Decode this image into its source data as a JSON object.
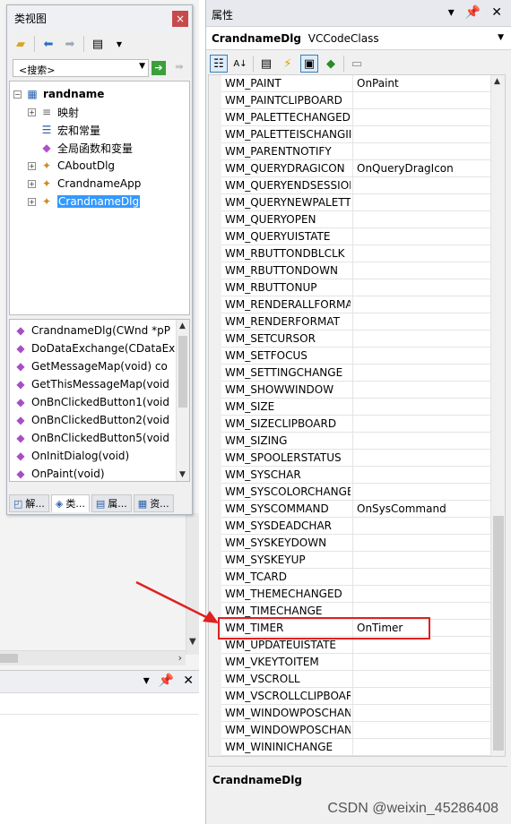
{
  "class_view": {
    "title": "类视图",
    "close": "×",
    "search_placeholder": "<搜索>",
    "tree": [
      {
        "label": "randname",
        "bold": true,
        "expander": "−",
        "icon": "project-icon"
      },
      {
        "label": "映射",
        "expander": "+",
        "icon": "map-icon"
      },
      {
        "label": "宏和常量",
        "icon": "macro-icon"
      },
      {
        "label": "全局函数和变量",
        "icon": "global-icon"
      },
      {
        "label": "CAboutDlg",
        "expander": "+",
        "icon": "class-icon"
      },
      {
        "label": "CrandnameApp",
        "expander": "+",
        "icon": "class-icon"
      },
      {
        "label": "CrandnameDlg",
        "expander": "+",
        "icon": "class-icon",
        "selected": true
      }
    ],
    "members": [
      "CrandnameDlg(CWnd *pP",
      "DoDataExchange(CDataEx",
      "GetMessageMap(void) co",
      "GetThisMessageMap(void",
      "OnBnClickedButton1(void",
      "OnBnClickedButton2(void",
      "OnBnClickedButton5(void",
      "OnInitDialog(void)",
      "OnPaint(void)"
    ],
    "tabs": [
      "解...",
      "类...",
      "属...",
      "资..."
    ]
  },
  "properties": {
    "title": "属性",
    "object_name": "CrandnameDlg",
    "object_type": "VCCodeClass",
    "rows": [
      {
        "name": "WM_PAINT",
        "value": "OnPaint"
      },
      {
        "name": "WM_PAINTCLIPBOARD",
        "value": ""
      },
      {
        "name": "WM_PALETTECHANGED",
        "value": ""
      },
      {
        "name": "WM_PALETTEISCHANGING",
        "value": ""
      },
      {
        "name": "WM_PARENTNOTIFY",
        "value": ""
      },
      {
        "name": "WM_QUERYDRAGICON",
        "value": "OnQueryDragIcon"
      },
      {
        "name": "WM_QUERYENDSESSION",
        "value": ""
      },
      {
        "name": "WM_QUERYNEWPALETTE",
        "value": ""
      },
      {
        "name": "WM_QUERYOPEN",
        "value": ""
      },
      {
        "name": "WM_QUERYUISTATE",
        "value": ""
      },
      {
        "name": "WM_RBUTTONDBLCLK",
        "value": ""
      },
      {
        "name": "WM_RBUTTONDOWN",
        "value": ""
      },
      {
        "name": "WM_RBUTTONUP",
        "value": ""
      },
      {
        "name": "WM_RENDERALLFORMATS",
        "value": ""
      },
      {
        "name": "WM_RENDERFORMAT",
        "value": ""
      },
      {
        "name": "WM_SETCURSOR",
        "value": ""
      },
      {
        "name": "WM_SETFOCUS",
        "value": ""
      },
      {
        "name": "WM_SETTINGCHANGE",
        "value": ""
      },
      {
        "name": "WM_SHOWWINDOW",
        "value": ""
      },
      {
        "name": "WM_SIZE",
        "value": ""
      },
      {
        "name": "WM_SIZECLIPBOARD",
        "value": ""
      },
      {
        "name": "WM_SIZING",
        "value": ""
      },
      {
        "name": "WM_SPOOLERSTATUS",
        "value": ""
      },
      {
        "name": "WM_SYSCHAR",
        "value": ""
      },
      {
        "name": "WM_SYSCOLORCHANGE",
        "value": ""
      },
      {
        "name": "WM_SYSCOMMAND",
        "value": "OnSysCommand"
      },
      {
        "name": "WM_SYSDEADCHAR",
        "value": ""
      },
      {
        "name": "WM_SYSKEYDOWN",
        "value": ""
      },
      {
        "name": "WM_SYSKEYUP",
        "value": ""
      },
      {
        "name": "WM_TCARD",
        "value": ""
      },
      {
        "name": "WM_THEMECHANGED",
        "value": ""
      },
      {
        "name": "WM_TIMECHANGE",
        "value": ""
      },
      {
        "name": "WM_TIMER",
        "value": "OnTimer",
        "highlighted": true
      },
      {
        "name": "WM_UPDATEUISTATE",
        "value": ""
      },
      {
        "name": "WM_VKEYTOITEM",
        "value": ""
      },
      {
        "name": "WM_VSCROLL",
        "value": ""
      },
      {
        "name": "WM_VSCROLLCLIPBOARD",
        "value": ""
      },
      {
        "name": "WM_WINDOWPOSCHANGED",
        "value": ""
      },
      {
        "name": "WM_WINDOWPOSCHANGING",
        "value": ""
      },
      {
        "name": "WM_WININICHANGE",
        "value": ""
      }
    ],
    "description_title": "CrandnameDlg"
  },
  "watermark": "CSDN @weixin_45286408",
  "colors": {
    "highlight": "#e02020",
    "selection": "#3399ff"
  }
}
